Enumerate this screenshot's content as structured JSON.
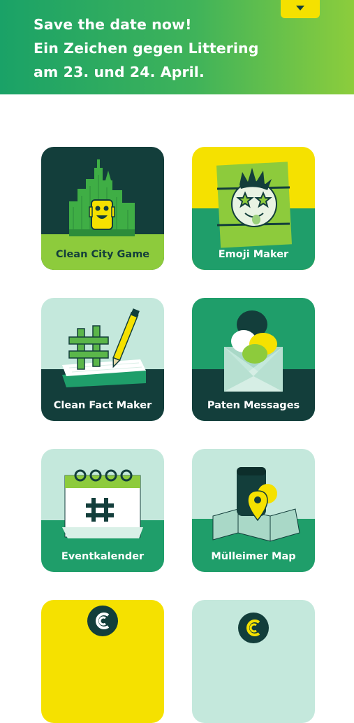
{
  "banner": {
    "lines": [
      "Save the date now!",
      "Ein Zeichen gegen Littering",
      "am 23. und 24. April."
    ],
    "button_icon": "chevron-down-icon"
  },
  "tiles": [
    {
      "label": "Clean City Game",
      "icon": "city-mascot-icon"
    },
    {
      "label": "Emoji Maker",
      "icon": "emoji-face-icon"
    },
    {
      "label": "Clean Fact Maker",
      "icon": "hashtag-notepad-icon"
    },
    {
      "label": "Paten Messages",
      "icon": "envelope-messages-icon"
    },
    {
      "label": "Eventkalender",
      "icon": "calendar-hashtag-icon"
    },
    {
      "label": "Mülleimer Map",
      "icon": "trashcan-map-pin-icon"
    },
    {
      "label": "",
      "icon": "clean-logo-icon"
    },
    {
      "label": "",
      "icon": "clean-logo-icon"
    }
  ],
  "colors": {
    "dark_teal": "#133e3b",
    "green": "#1f9e6a",
    "lime": "#8dcb3c",
    "yellow": "#f5e100",
    "mint": "#c4e8dc"
  }
}
